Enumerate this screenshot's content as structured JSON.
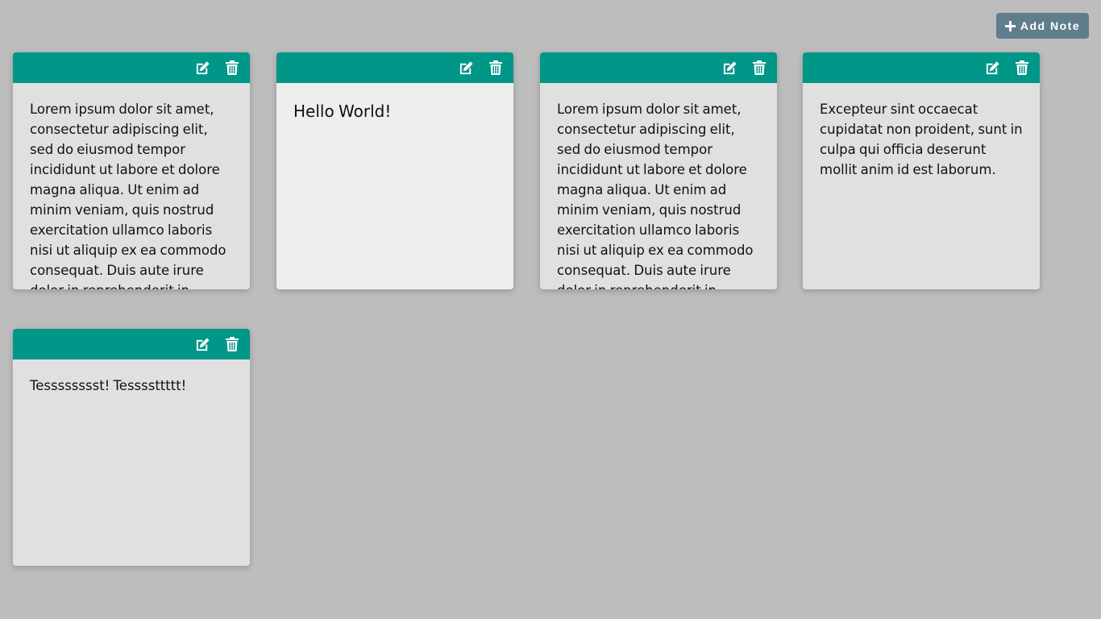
{
  "toolbar": {
    "add_note_label": "Add Note",
    "add_icon": "plus-icon"
  },
  "colors": {
    "background": "#bdbdbd",
    "note_header": "#009688",
    "add_button": "#607d8b",
    "note_body": "#e0e0e0",
    "note_body_selected": "#eeeeee"
  },
  "notes": [
    {
      "text": "Lorem ipsum dolor sit amet, consectetur adipiscing elit, sed do eiusmod tempor incididunt ut labore et dolore magna aliqua. Ut enim ad minim veniam, quis nostrud exercitation ullamco laboris nisi ut aliquip ex ea commodo consequat. Duis aute irure dolor in reprehenderit in voluptate velit esse cillum dolore eu fugiat nulla pariatur.",
      "edit_icon": "edit-icon",
      "delete_icon": "trash-icon"
    },
    {
      "text": "Hello World!",
      "edit_icon": "edit-icon",
      "delete_icon": "trash-icon"
    },
    {
      "text": "Lorem ipsum dolor sit amet, consectetur adipiscing elit, sed do eiusmod tempor incididunt ut labore et dolore magna aliqua. Ut enim ad minim veniam, quis nostrud exercitation ullamco laboris nisi ut aliquip ex ea commodo consequat. Duis aute irure dolor in reprehenderit in voluptate velit esse cillum dolore eu fugiat nulla pariatur.",
      "edit_icon": "edit-icon",
      "delete_icon": "trash-icon"
    },
    {
      "text": "Excepteur sint occaecat cupidatat non proident, sunt in culpa qui officia deserunt mollit anim id est laborum.",
      "edit_icon": "edit-icon",
      "delete_icon": "trash-icon"
    },
    {
      "text": "Tesssssssst! Tessssttttt!",
      "edit_icon": "edit-icon",
      "delete_icon": "trash-icon"
    }
  ]
}
